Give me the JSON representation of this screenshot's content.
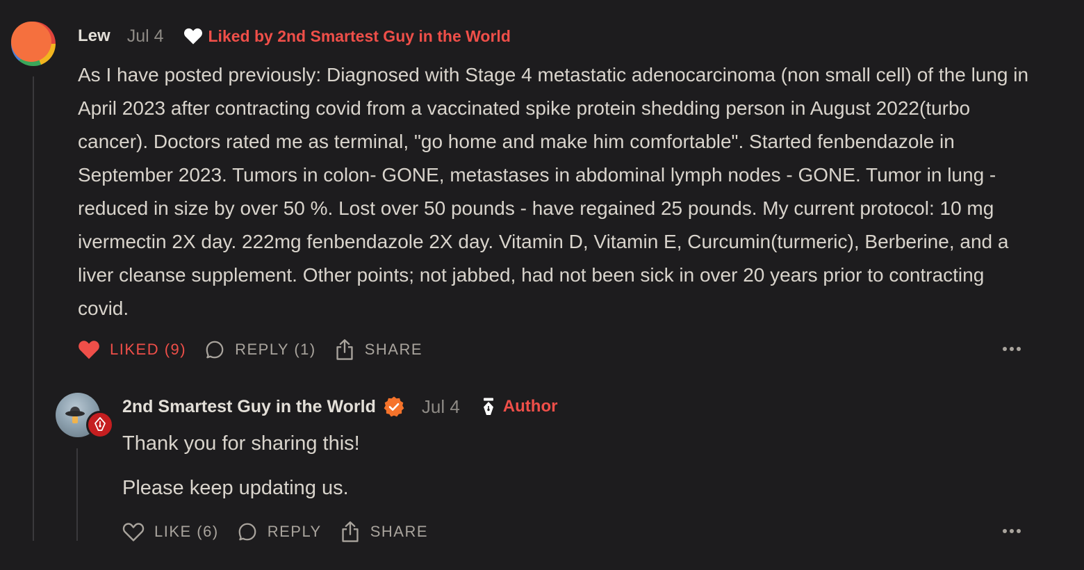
{
  "comment": {
    "author": "Lew",
    "date": "Jul 4",
    "liked_by": "Liked by 2nd Smartest Guy in the World",
    "body": "As I have posted previously: Diagnosed with Stage 4 metastatic adenocarcinoma (non small cell) of the lung in April 2023 after contracting covid from a vaccinated spike protein shedding person in August 2022(turbo cancer). Doctors rated me as terminal, \"go home and make him comfortable\". Started fenbendazole in September 2023. Tumors in colon- GONE, metastases in abdominal lymph nodes - GONE. Tumor in lung - reduced in size by over 50 %. Lost over 50 pounds - have regained 25 pounds. My current protocol: 10 mg ivermectin 2X day. 222mg fenbendazole 2X day. Vitamin D, Vitamin E, Curcumin(turmeric), Berberine, and a liver cleanse supplement. Other points; not jabbed, had not been sick in over 20 years prior to contracting covid.",
    "actions": {
      "like_label": "LIKED (9)",
      "reply_label": "REPLY (1)",
      "share_label": "SHARE"
    }
  },
  "reply": {
    "author": "2nd Smartest Guy in the World",
    "date": "Jul 4",
    "author_tag": "Author",
    "paragraphs": [
      "Thank you for sharing this!",
      "Please keep updating us."
    ],
    "actions": {
      "like_label": "LIKE (6)",
      "reply_label": "REPLY",
      "share_label": "SHARE"
    }
  },
  "colors": {
    "background": "#1d1c1e",
    "accent_red": "#ef4f49",
    "verified_orange": "#f5732b",
    "muted_text": "#a9a49d"
  },
  "icons": [
    "heart-icon",
    "comment-icon",
    "share-icon",
    "more-icon",
    "verified-icon",
    "pen-nib-icon"
  ]
}
